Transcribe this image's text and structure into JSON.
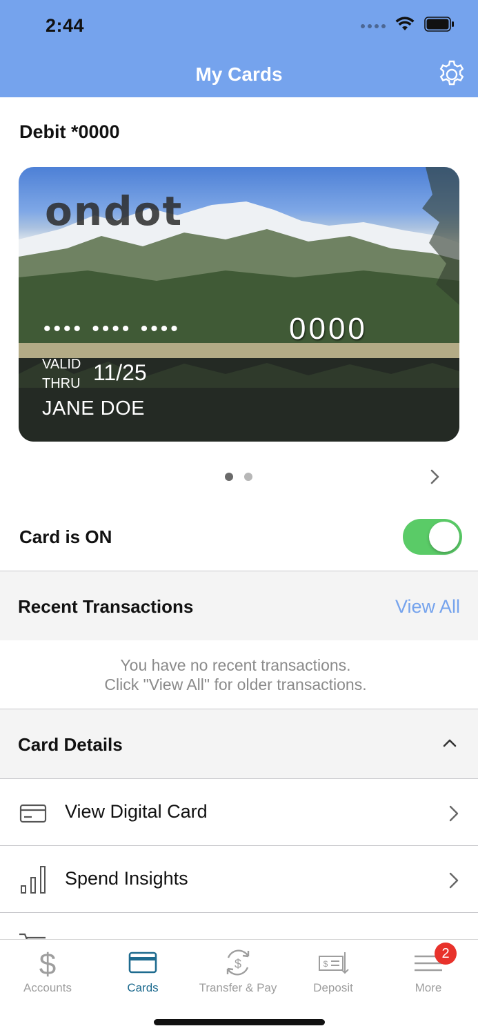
{
  "status_bar": {
    "time": "2:44"
  },
  "header": {
    "title": "My Cards",
    "settings_icon": "gear-icon"
  },
  "account": {
    "label": "Debit *0000"
  },
  "card": {
    "brand": "ondot",
    "masked_groups": "•••• •••• ••••",
    "last4": "0000",
    "valid_line1": "VALID",
    "valid_line2": "THRU",
    "expiry": "11/25",
    "holder": "JANE DOE"
  },
  "pager": {
    "pages": 2,
    "current": 1
  },
  "card_status": {
    "label": "Card is ON",
    "enabled": true
  },
  "recent": {
    "title": "Recent Transactions",
    "view_all": "View All",
    "empty_line1": "You have no recent transactions.",
    "empty_line2": "Click \"View All\" for older transactions."
  },
  "details": {
    "title": "Card Details",
    "items": [
      {
        "label": "View Digital Card",
        "icon": "card-icon"
      },
      {
        "label": "Spend Insights",
        "icon": "bar-chart-icon"
      }
    ]
  },
  "tabs": [
    {
      "label": "Accounts",
      "icon": "dollar-icon",
      "active": false
    },
    {
      "label": "Cards",
      "icon": "card-icon",
      "active": true
    },
    {
      "label": "Transfer & Pay",
      "icon": "transfer-icon",
      "active": false
    },
    {
      "label": "Deposit",
      "icon": "check-deposit-icon",
      "active": false
    },
    {
      "label": "More",
      "icon": "menu-icon",
      "active": false,
      "badge": "2"
    }
  ],
  "colors": {
    "header": "#75a3ed",
    "toggle_on": "#5acb67",
    "active_tab": "#1e6b8f",
    "badge": "#e8322b",
    "link": "#75a3ed"
  }
}
